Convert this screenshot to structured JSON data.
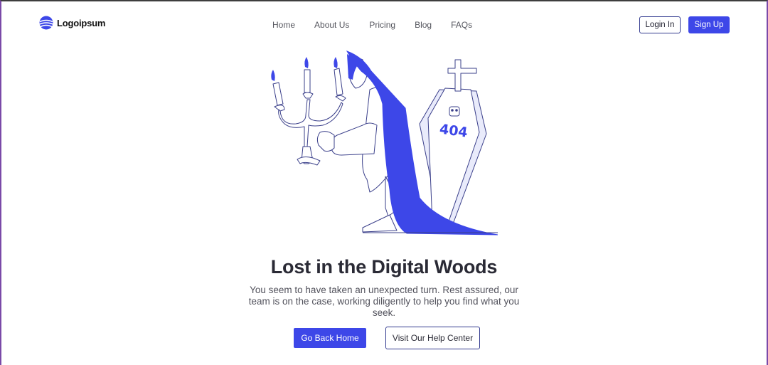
{
  "brand": {
    "name": "Logoipsum",
    "color": "#3d47e8"
  },
  "nav": {
    "items": [
      {
        "label": "Home"
      },
      {
        "label": "About Us"
      },
      {
        "label": "Pricing"
      },
      {
        "label": "Blog"
      },
      {
        "label": "FAQs"
      }
    ]
  },
  "auth": {
    "login_label": "Login In",
    "signup_label": "Sign Up"
  },
  "illustration": {
    "tombstone_text": "404",
    "icon": "vampire-404-illustration"
  },
  "main": {
    "title": "Lost in the Digital Woods",
    "subtitle": "You seem to have taken an unexpected turn. Rest assured, our team is on the case, working diligently to help you find what you seek.",
    "primary_button": "Go Back Home",
    "secondary_button": "Visit Our Help Center"
  },
  "colors": {
    "accent": "#3d47e8",
    "outline": "#323a8f",
    "light_fill": "#e7e9fb"
  }
}
